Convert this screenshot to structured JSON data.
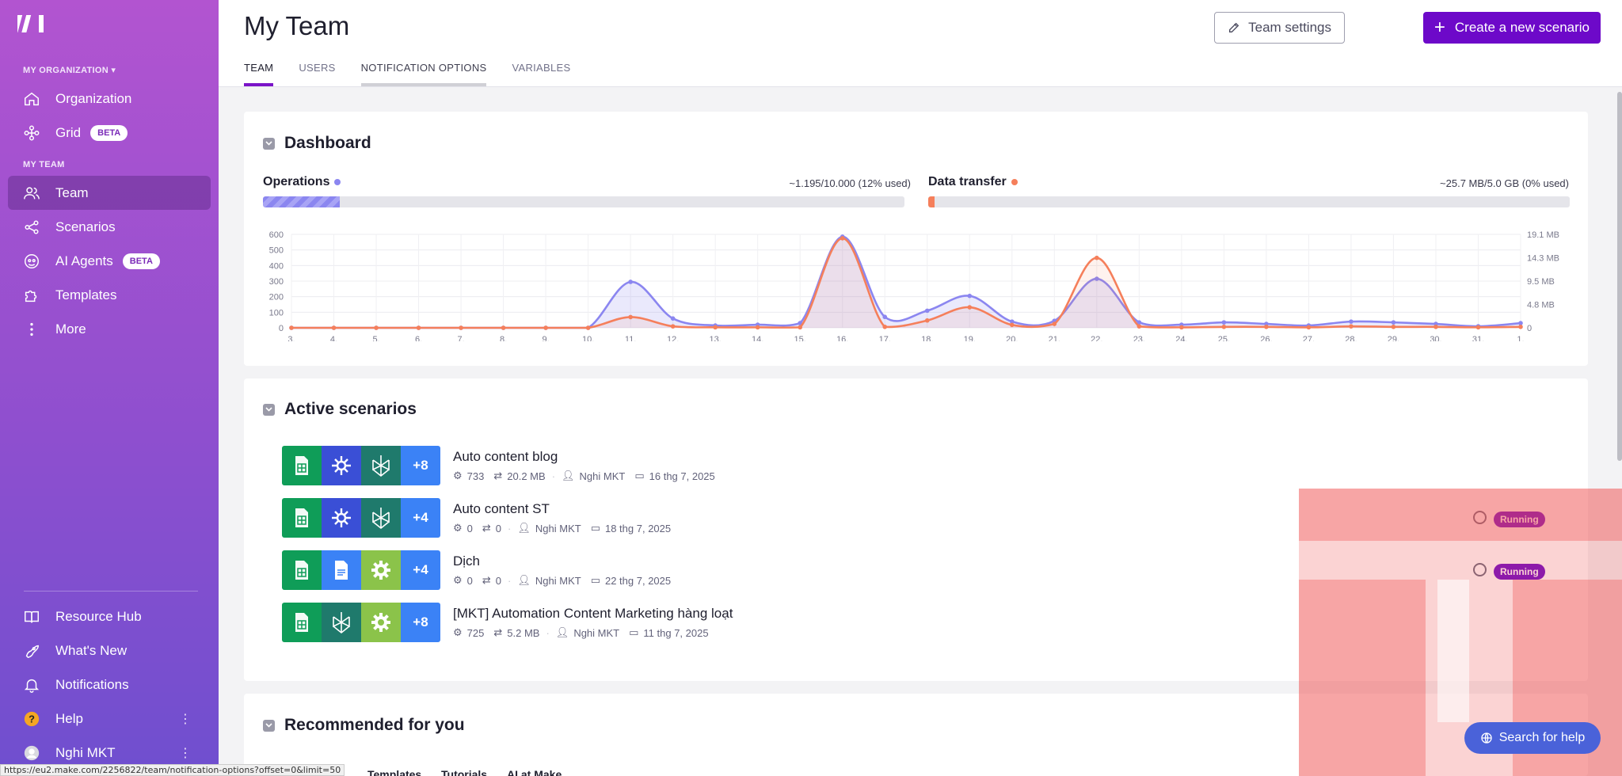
{
  "sidebar": {
    "org_label": "MY ORGANIZATION",
    "team_label": "MY TEAM",
    "items": [
      {
        "label": "Organization",
        "icon": "home-icon"
      },
      {
        "label": "Grid",
        "icon": "grid-icon",
        "badge": "BETA"
      },
      {
        "label": "Team",
        "icon": "users-icon",
        "active": true
      },
      {
        "label": "Scenarios",
        "icon": "share-icon"
      },
      {
        "label": "AI Agents",
        "icon": "ai-agent-icon",
        "badge": "BETA"
      },
      {
        "label": "Templates",
        "icon": "puzzle-icon"
      },
      {
        "label": "More",
        "icon": "more-vertical-icon"
      }
    ],
    "bottom": [
      {
        "label": "Resource Hub",
        "icon": "book-icon"
      },
      {
        "label": "What's New",
        "icon": "rocket-icon"
      },
      {
        "label": "Notifications",
        "icon": "bell-icon"
      },
      {
        "label": "Help",
        "icon": "help-icon"
      },
      {
        "label": "Nghi MKT",
        "icon": "avatar"
      }
    ]
  },
  "header": {
    "title": "My Team",
    "tabs": [
      "TEAM",
      "USERS",
      "NOTIFICATION OPTIONS",
      "VARIABLES"
    ],
    "settings_label": "Team settings",
    "create_label": "Create a new scenario"
  },
  "dashboard": {
    "title": "Dashboard",
    "operations_label": "Operations",
    "operations_value": "~1.195/10.000 (12% used)",
    "operations_used": 0.12,
    "transfer_label": "Data transfer",
    "transfer_value": "~25.7 MB/5.0 GB (0% used)",
    "transfer_used": 0.01,
    "colors": {
      "operations": "#8b86f0",
      "transfer": "#f57f5b"
    }
  },
  "chart_data": {
    "type": "line",
    "x": [
      "3.",
      "4.",
      "5.",
      "6.",
      "7.",
      "8.",
      "9.",
      "10.",
      "11.",
      "12.",
      "13.",
      "14.",
      "15.",
      "16.",
      "17.",
      "18.",
      "19.",
      "20.",
      "21.",
      "22.",
      "23.",
      "24.",
      "25.",
      "26.",
      "27.",
      "28.",
      "29.",
      "30.",
      "31.",
      "1."
    ],
    "y_left_ticks": [
      "600",
      "500",
      "400",
      "300",
      "200",
      "100",
      "0"
    ],
    "y_right_ticks": [
      "19.1 MB",
      "14.3 MB",
      "9.5 MB",
      "4.8 MB",
      "0"
    ],
    "ylim_left": [
      0,
      600
    ],
    "ylim_right": [
      0,
      19.1
    ],
    "series": [
      {
        "values": [
          0,
          0,
          0,
          0,
          0,
          0,
          0,
          0,
          295,
          60,
          15,
          20,
          30,
          585,
          70,
          110,
          205,
          40,
          45,
          315,
          35,
          20,
          35,
          25,
          15,
          40,
          35,
          25,
          10,
          30
        ]
      },
      {
        "values": [
          0,
          0,
          0,
          0,
          0,
          0,
          0,
          0,
          2.2,
          0.3,
          0.1,
          0.1,
          0.1,
          18.3,
          0.2,
          1.5,
          4.2,
          0.6,
          0.8,
          14.3,
          0.3,
          0.1,
          0.2,
          0.2,
          0.1,
          0.3,
          0.2,
          0.2,
          0.1,
          0.2
        ]
      }
    ],
    "grid": true
  },
  "active": {
    "title": "Active scenarios",
    "rows": [
      {
        "name": "Auto content blog",
        "ops": "733",
        "data": "20.2 MB",
        "user": "Nghi MKT",
        "date": "16 thg 7, 2025",
        "more": "+8",
        "status": ""
      },
      {
        "name": "Auto content ST",
        "ops": "0",
        "data": "0",
        "user": "Nghi MKT",
        "date": "18 thg 7, 2025",
        "more": "+4",
        "status": "Running"
      },
      {
        "name": "Dịch",
        "ops": "0",
        "data": "0",
        "user": "Nghi MKT",
        "date": "22 thg 7, 2025",
        "more": "+4",
        "status": "Running"
      },
      {
        "name": "[MKT] Automation Content Marketing hàng loạt",
        "ops": "725",
        "data": "5.2 MB",
        "user": "Nghi MKT",
        "date": "11 thg 7, 2025",
        "more": "+8",
        "status": ""
      }
    ]
  },
  "recommended": {
    "title": "Recommended for you",
    "tabs": [
      "Templates",
      "Tutorials",
      "AI at Make"
    ]
  },
  "help_label": "Search for help",
  "status_url": "https://eu2.make.com/2256822/team/notification-options?offset=0&limit=50"
}
